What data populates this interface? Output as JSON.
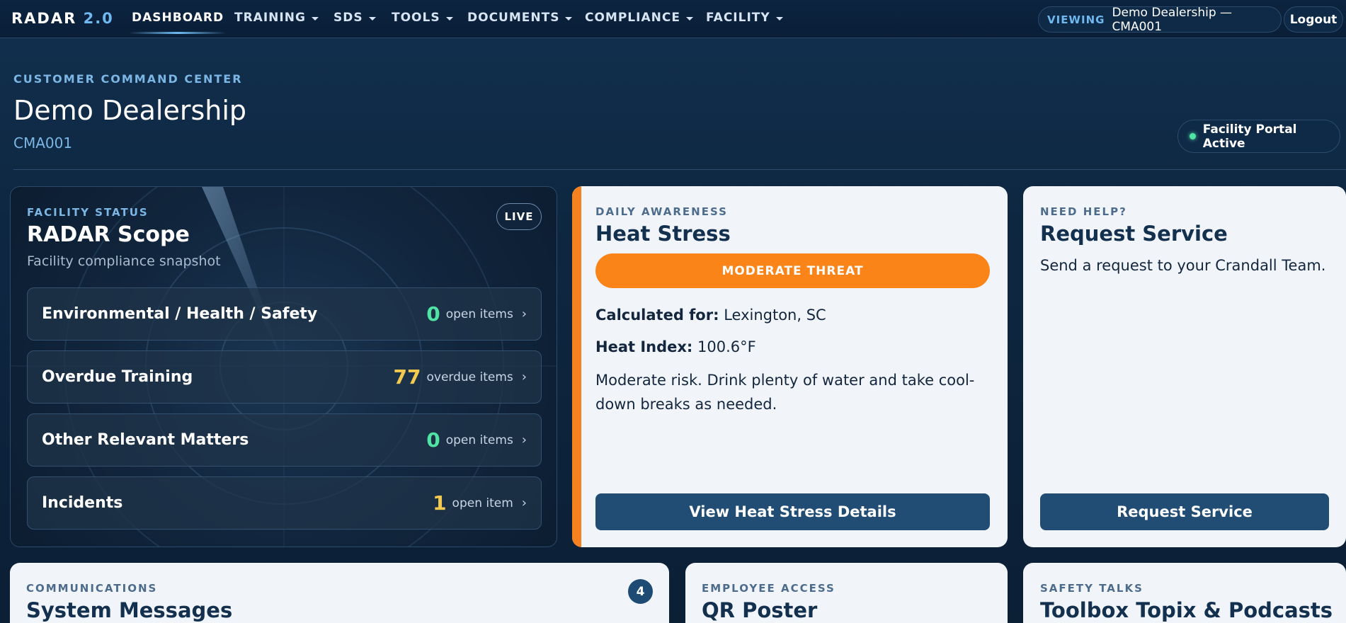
{
  "nav": {
    "brand": "RADAR",
    "brand_version": "2.0",
    "items": [
      {
        "label": "DASHBOARD"
      },
      {
        "label": "TRAINING"
      },
      {
        "label": "SDS"
      },
      {
        "label": "TOOLS"
      },
      {
        "label": "DOCUMENTS"
      },
      {
        "label": "COMPLIANCE"
      },
      {
        "label": "FACILITY"
      }
    ],
    "viewing_label": "VIEWING",
    "viewing_value": "Demo Dealership — CMA001",
    "logout_label": "Logout"
  },
  "header": {
    "eyebrow": "CUSTOMER COMMAND CENTER",
    "title": "Demo Dealership",
    "code": "CMA001",
    "portal_status": "Facility Portal Active"
  },
  "radar": {
    "eyebrow": "FACILITY STATUS",
    "title": "RADAR Scope",
    "subtitle": "Facility compliance snapshot",
    "live_label": "LIVE",
    "rows": [
      {
        "label": "Environmental / Health / Safety",
        "count": "0",
        "type": "open items",
        "color": "#4fe3a4"
      },
      {
        "label": "Overdue Training",
        "count": "77",
        "type": "overdue items",
        "color": "#f4c94f"
      },
      {
        "label": "Other Relevant Matters",
        "count": "0",
        "type": "open items",
        "color": "#4fe3a4"
      },
      {
        "label": "Incidents",
        "count": "1",
        "type": "open item",
        "color": "#f4c94f"
      }
    ]
  },
  "heat": {
    "eyebrow": "DAILY AWARENESS",
    "title": "Heat Stress",
    "threat": "MODERATE THREAT",
    "calc_label": "Calculated for:",
    "calc_value": "Lexington, SC",
    "index_label": "Heat Index:",
    "index_value": "100.6°F",
    "description": "Moderate risk. Drink plenty of water and take cool-down breaks as needed.",
    "button": "View Heat Stress Details",
    "accent": "#f5821f"
  },
  "service": {
    "eyebrow": "NEED HELP?",
    "title": "Request Service",
    "description": "Send a request to your Crandall Team.",
    "button": "Request Service"
  },
  "messages": {
    "eyebrow": "COMMUNICATIONS",
    "title": "System Messages",
    "badge": "4"
  },
  "qr": {
    "eyebrow": "EMPLOYEE ACCESS",
    "title": "QR Poster"
  },
  "talks": {
    "eyebrow": "SAFETY TALKS",
    "title": "Toolbox Topix & Podcasts"
  }
}
